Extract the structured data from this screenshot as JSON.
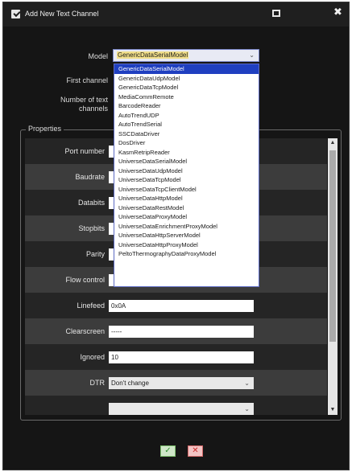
{
  "window": {
    "title": "Add New Text Channel",
    "title_icon": "checkbox-edit-icon",
    "restore_icon": "restore-icon",
    "close_icon": "close-icon",
    "close_glyph": "✖"
  },
  "form": {
    "model_label": "Model",
    "model_value": "GenericDataSerialModel",
    "first_channel_label": "First channel",
    "number_label_line1": "Number of text",
    "number_label_line2": "channels",
    "chevron": "⌄"
  },
  "dropdown": {
    "options": [
      "GenericDataSerialModel",
      "GenericDataUdpModel",
      "GenericDataTcpModel",
      "MediaCommRemote",
      "BarcodeReader",
      "AutoTrendUDP",
      "AutoTrendSerial",
      "SSCDataDriver",
      "DosDriver",
      "KasmRetripReader",
      "UniverseDataSerialModel",
      "UniverseDataUdpModel",
      "UniverseDataTcpModel",
      "UniverseDataTcpClientModel",
      "UniverseDataHttpModel",
      "UniverseDataRestModel",
      "UniverseDataProxyModel",
      "UniverseDataEnrichmentProxyModel",
      "UniverseDataHttpServerModel",
      "UniverseDataHttpProxyModel",
      "PeltoThermographyDataProxyModel"
    ],
    "selected_index": 0
  },
  "properties": {
    "legend": "Properties",
    "rows": [
      {
        "label": "Port number",
        "kind": "stub",
        "value": ""
      },
      {
        "label": "Baudrate",
        "kind": "stub",
        "value": ""
      },
      {
        "label": "Databits",
        "kind": "stub",
        "value": ""
      },
      {
        "label": "Stopbits",
        "kind": "stub",
        "value": ""
      },
      {
        "label": "Parity",
        "kind": "stub",
        "value": ""
      },
      {
        "label": "Flow control",
        "kind": "stub",
        "value": ""
      },
      {
        "label": "Linefeed",
        "kind": "input",
        "value": "0x0A"
      },
      {
        "label": "Clearscreen",
        "kind": "input",
        "value": "-----"
      },
      {
        "label": "Ignored",
        "kind": "input",
        "value": "10"
      },
      {
        "label": "DTR",
        "kind": "select",
        "value": "Don't change"
      },
      {
        "label": "",
        "kind": "select",
        "value": ""
      }
    ]
  },
  "scrollbar": {
    "up_glyph": "▲",
    "down_glyph": "▼"
  },
  "buttons": {
    "ok_glyph": "✓",
    "cancel_glyph": "✕"
  },
  "colors": {
    "background": "#151515",
    "row_dark": "#252525",
    "row_light": "#3c3c3c",
    "dropdown_selected": "#1f3fc0",
    "ok_green": "#2f8f2f",
    "cancel_red": "#cc2a2a"
  }
}
